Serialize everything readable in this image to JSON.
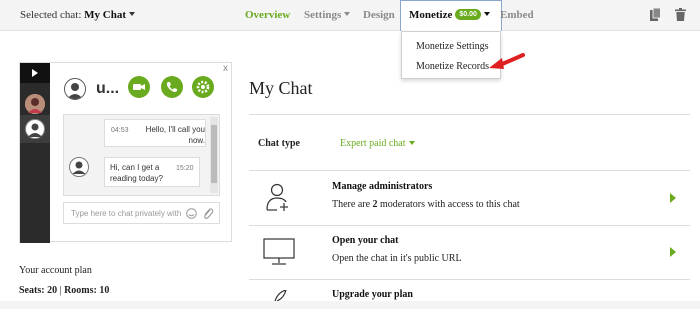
{
  "topbar": {
    "selected_chat_prefix": "Selected chat:",
    "selected_chat_name": "My Chat",
    "tabs": {
      "overview": "Overview",
      "settings": "Settings",
      "design": "Design",
      "monetize": "Monetize",
      "monetize_badge": "$0.00",
      "embed": "Embed"
    }
  },
  "monetize_menu": {
    "items": [
      "Monetize Settings",
      "Monetize Records"
    ]
  },
  "widget": {
    "user_name": "u...",
    "close_glyph": "x",
    "messages": [
      {
        "time": "04:53",
        "text": "Hello, I'll call you now."
      },
      {
        "time": "15:20",
        "text": "Hi, can I get a reading today?"
      }
    ],
    "input_placeholder": "Type here to chat privately with"
  },
  "plan": {
    "label": "Your account plan",
    "seats_label": "Seats:",
    "seats_value": "20",
    "separator": "|",
    "rooms_label": "Rooms:",
    "rooms_value": "10"
  },
  "main": {
    "title": "My Chat",
    "chat_type_label": "Chat type",
    "chat_type_value": "Expert paid chat",
    "rows": [
      {
        "title": "Manage administrators",
        "desc_pre": "There are",
        "desc_count": "2",
        "desc_post": "moderators with access to this chat"
      },
      {
        "title": "Open your chat",
        "desc": "Open the chat in it's public URL"
      },
      {
        "title": "Upgrade your plan"
      }
    ]
  },
  "colors": {
    "accent": "#6aaa1e",
    "pointer": "#e02020",
    "topbar_bg": "#f4f4f4"
  }
}
